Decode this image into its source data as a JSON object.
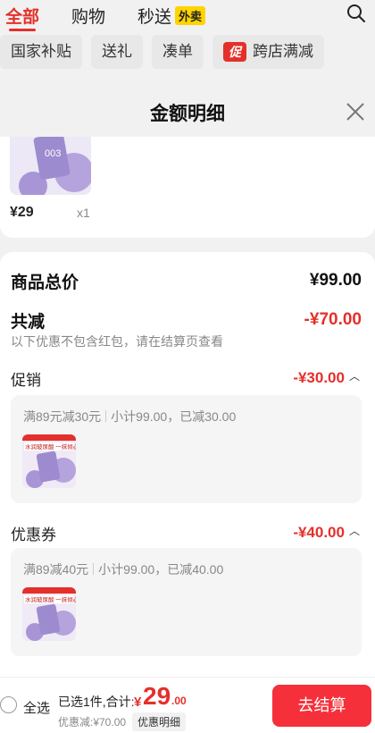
{
  "nav": {
    "tabs": [
      {
        "label": "全部",
        "active": true
      },
      {
        "label": "购物",
        "active": false
      },
      {
        "label": "秒送",
        "active": false
      }
    ],
    "waimai_badge": "外卖",
    "chips": [
      "国家补贴",
      "送礼",
      "凑单",
      "跨店满减"
    ],
    "chip_badge": "促"
  },
  "sheet": {
    "title": "金额明细"
  },
  "product": {
    "image_text": "003",
    "price": "¥29",
    "qty": "x1"
  },
  "breakdown": {
    "total_label": "商品总价",
    "total_value": "¥99.00",
    "reduce_label": "共减",
    "reduce_value": "-¥70.00",
    "note": "以下优惠不包含红包，请在结算页查看",
    "promo": {
      "label": "促销",
      "value": "-¥30.00",
      "rule": "满89元减30元",
      "detail": "小计99.00，已减30.00"
    },
    "coupon": {
      "label": "优惠券",
      "value": "-¥40.00",
      "rule": "满89减40元",
      "detail": "小计99.00，已减40.00"
    },
    "thumb_banner": "水润玻尿酸 一抹倾心"
  },
  "bottom": {
    "select_all": "全选",
    "summary": "已选1件,合计:",
    "yen": "¥",
    "total_int": "29",
    "total_dec": ".00",
    "discount": "优惠减:¥70.00",
    "detail_btn": "优惠明细",
    "checkout": "去结算"
  },
  "colors": {
    "accent": "#e4302b",
    "checkout": "#f5303a",
    "waimai": "#ffd400"
  }
}
